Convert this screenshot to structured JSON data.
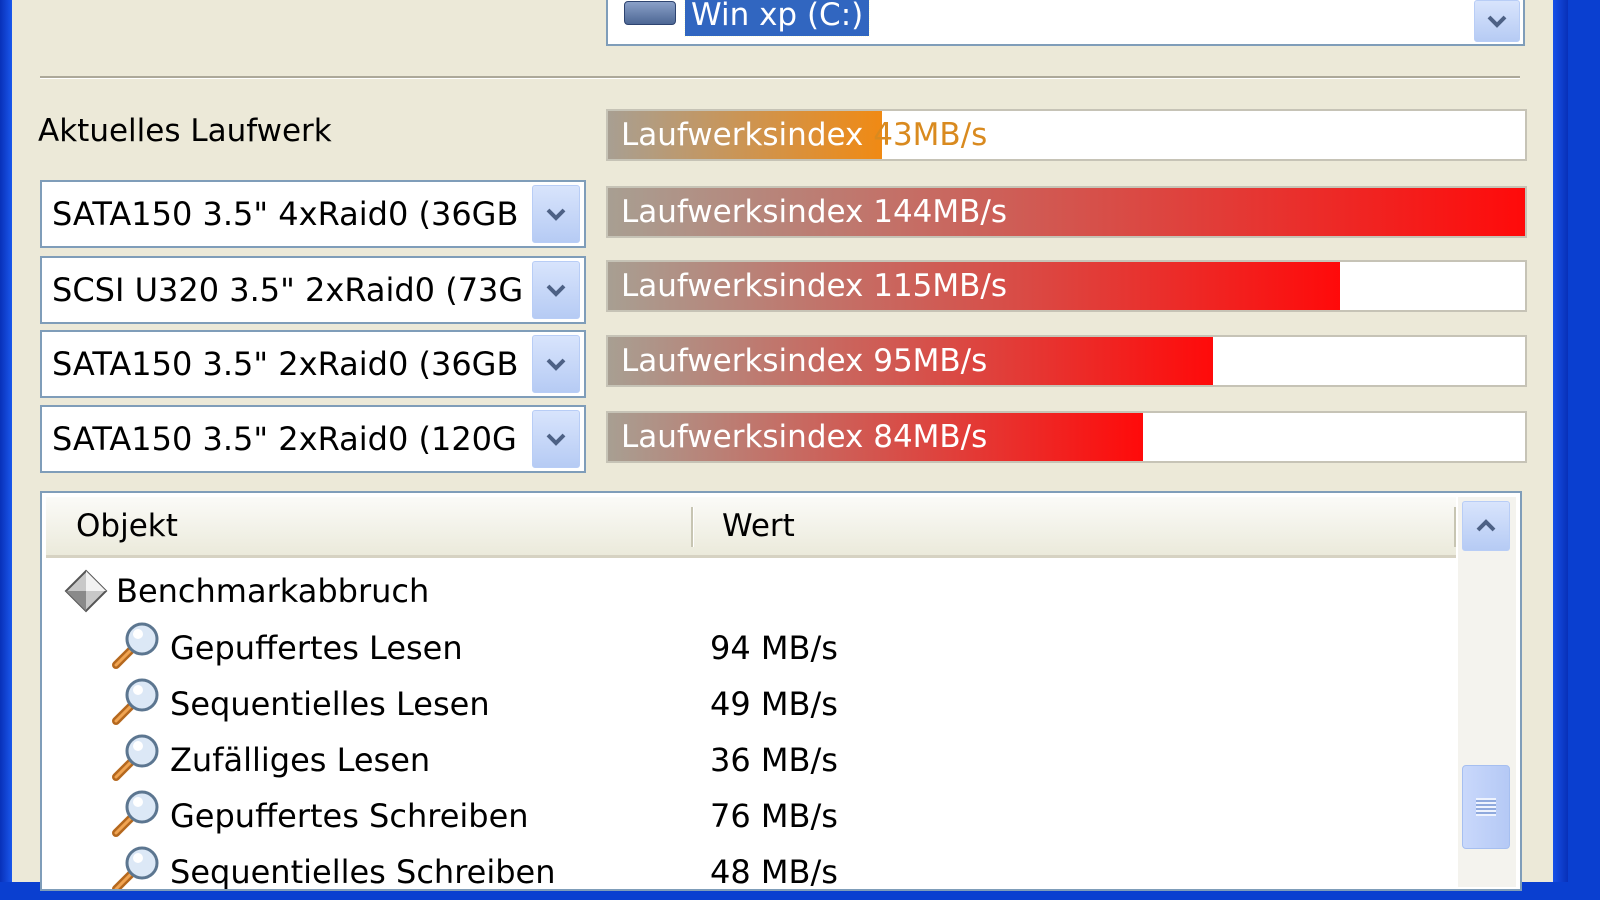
{
  "drive_selector": {
    "selected": "Win xp (C:)",
    "icon": "hard-drive-icon"
  },
  "current_drive_label": "Aktuelles Laufwerk",
  "current_bar": {
    "label": "Laufwerksindex",
    "value_text": "43MB/s",
    "value": 43,
    "fill_color": "#f08a14"
  },
  "comparisons": [
    {
      "device": "SATA150 3.5\" 4xRaid0 (36GB",
      "label": "Laufwerksindex 144MB/s",
      "value": 144
    },
    {
      "device": "SCSI U320 3.5\" 2xRaid0 (73G",
      "label": "Laufwerksindex 115MB/s",
      "value": 115
    },
    {
      "device": "SATA150 3.5\" 2xRaid0 (36GB",
      "label": "Laufwerksindex 95MB/s",
      "value": 95
    },
    {
      "device": "SATA150 3.5\" 2xRaid0 (120G",
      "label": "Laufwerksindex 84MB/s",
      "value": 84
    }
  ],
  "bar_max": 144,
  "comparison_fill_color": "#ff0a0a",
  "table": {
    "columns": [
      "Objekt",
      "Wert"
    ],
    "group": {
      "label": "Benchmarkabbruch",
      "icon": "diamond-icon"
    },
    "rows": [
      {
        "name": "Gepuffertes Lesen",
        "value": "94 MB/s",
        "icon": "magnifier-icon"
      },
      {
        "name": "Sequentielles Lesen",
        "value": "49 MB/s",
        "icon": "magnifier-icon"
      },
      {
        "name": "Zufälliges Lesen",
        "value": "36 MB/s",
        "icon": "magnifier-icon"
      },
      {
        "name": "Gepuffertes Schreiben",
        "value": "76 MB/s",
        "icon": "magnifier-icon"
      },
      {
        "name": "Sequentielles Schreiben",
        "value": "48 MB/s",
        "icon": "magnifier-icon"
      }
    ]
  }
}
